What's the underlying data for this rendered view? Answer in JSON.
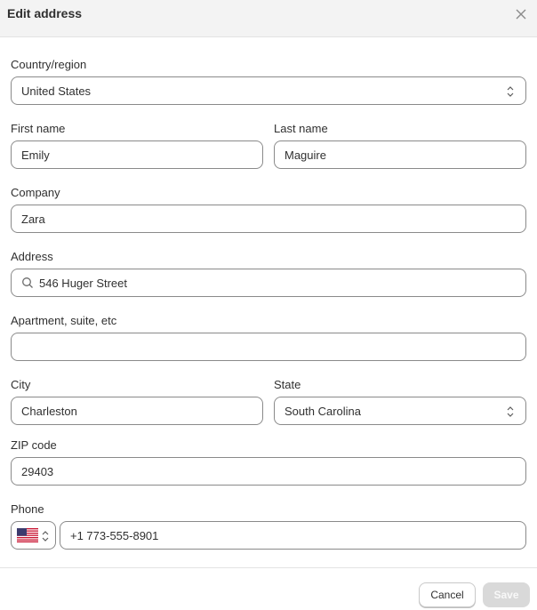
{
  "dialog": {
    "title": "Edit address",
    "close_icon": "close-icon"
  },
  "fields": {
    "country": {
      "label": "Country/region",
      "value": "United States"
    },
    "first_name": {
      "label": "First name",
      "value": "Emily"
    },
    "last_name": {
      "label": "Last name",
      "value": "Maguire"
    },
    "company": {
      "label": "Company",
      "value": "Zara"
    },
    "address": {
      "label": "Address",
      "value": "546 Huger Street",
      "icon": "search-icon"
    },
    "apartment": {
      "label": "Apartment, suite, etc",
      "value": ""
    },
    "city": {
      "label": "City",
      "value": "Charleston"
    },
    "state": {
      "label": "State",
      "value": "South Carolina"
    },
    "zip": {
      "label": "ZIP code",
      "value": "29403"
    },
    "phone": {
      "label": "Phone",
      "value": "+1 773-555-8901",
      "country_flag": "us-flag-icon"
    }
  },
  "footer": {
    "cancel_label": "Cancel",
    "save_label": "Save"
  }
}
